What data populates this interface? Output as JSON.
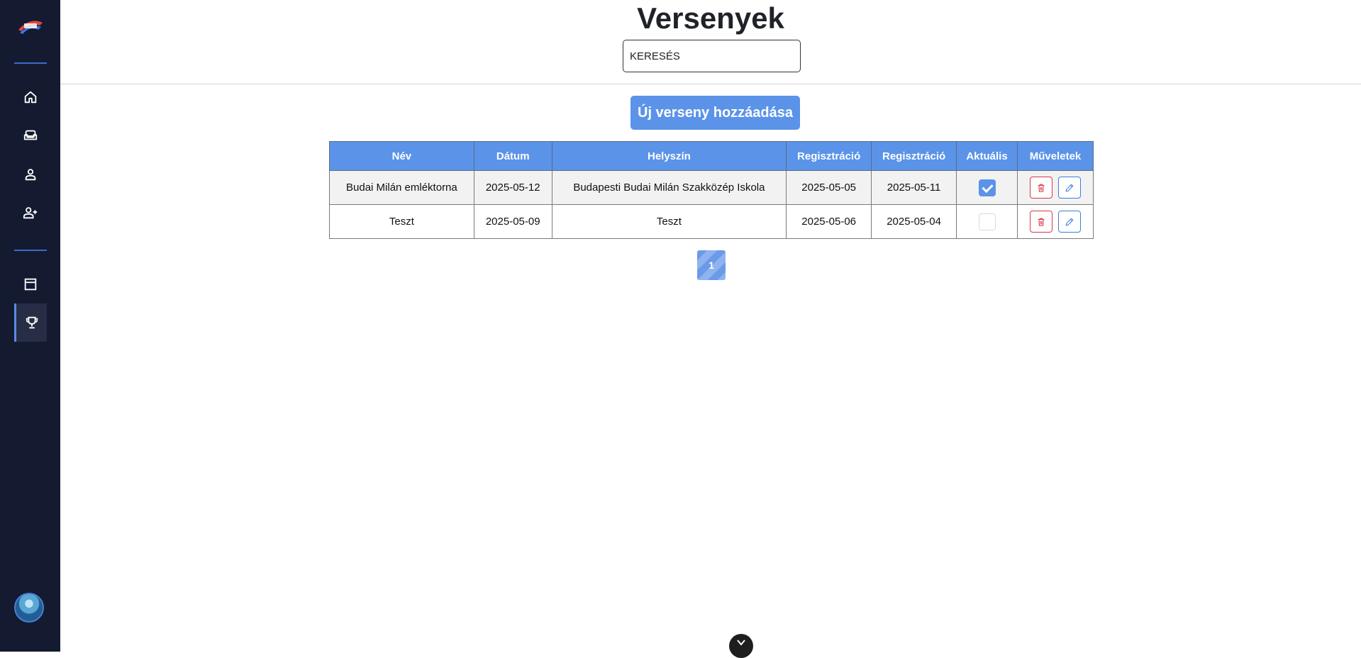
{
  "page": {
    "title": "Versenyek"
  },
  "search": {
    "placeholder": "KERESÉS"
  },
  "toolbar": {
    "add_label": "Új verseny hozzáadása"
  },
  "sidebar": {
    "items": [
      {
        "icon": "home-icon"
      },
      {
        "icon": "sofa-icon"
      },
      {
        "icon": "user-icon"
      },
      {
        "icon": "user-plus-icon"
      },
      {
        "icon": "archive-icon"
      },
      {
        "icon": "trophy-icon",
        "active": true
      }
    ]
  },
  "table": {
    "headers": [
      "Név",
      "Dátum",
      "Helyszín",
      "Regisztráció",
      "Regisztráció",
      "Aktuális",
      "Műveletek"
    ],
    "rows": [
      {
        "name": "Budai Milán emléktorna",
        "date": "2025-05-12",
        "location": "Budapesti Budai Milán Szakközép Iskola",
        "reg_start": "2025-05-05",
        "reg_end": "2025-05-11",
        "current": true
      },
      {
        "name": "Teszt",
        "date": "2025-05-09",
        "location": "Teszt",
        "reg_start": "2025-05-06",
        "reg_end": "2025-05-04",
        "current": false
      }
    ]
  },
  "pagination": {
    "current": "1"
  },
  "colors": {
    "accent": "#5b93e8",
    "sidebar": "#141a30",
    "danger": "#dc3545"
  }
}
